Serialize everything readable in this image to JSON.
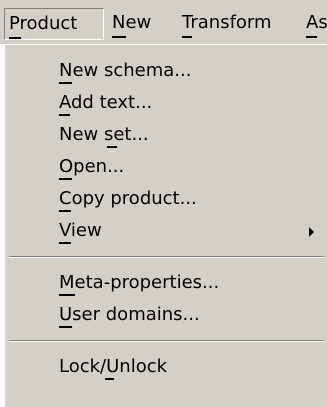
{
  "menubar": {
    "items": [
      {
        "label": "Product"
      },
      {
        "label": "New"
      },
      {
        "label": "Transform"
      },
      {
        "label": "As"
      }
    ]
  },
  "dropdown": {
    "items": [
      {
        "label": "New schema..."
      },
      {
        "label": "Add text..."
      },
      {
        "label": "New set..."
      },
      {
        "label": "Open..."
      },
      {
        "label": "Copy product..."
      },
      {
        "label": "View"
      },
      {
        "label": "Meta-properties..."
      },
      {
        "label": "User domains..."
      },
      {
        "label": "Lock/Unlock"
      }
    ]
  }
}
